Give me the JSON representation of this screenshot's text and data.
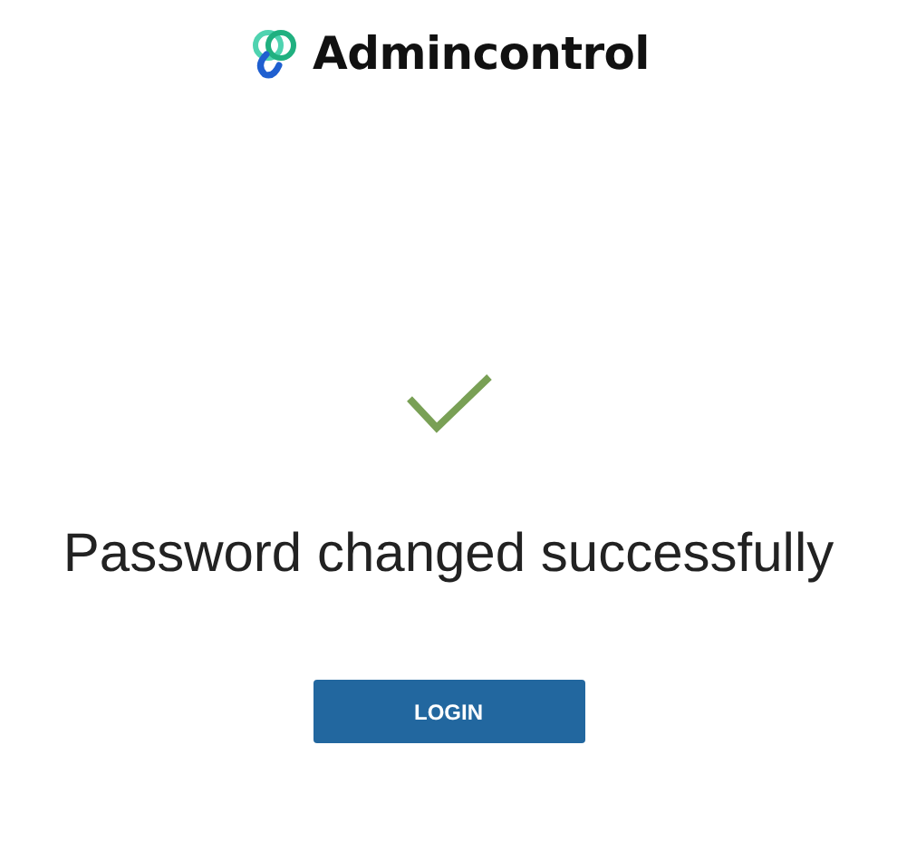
{
  "brand": {
    "name": "Admincontrol"
  },
  "message": "Password changed successfully",
  "buttons": [
    {
      "label": "LOGIN",
      "kind": "primary"
    }
  ]
}
